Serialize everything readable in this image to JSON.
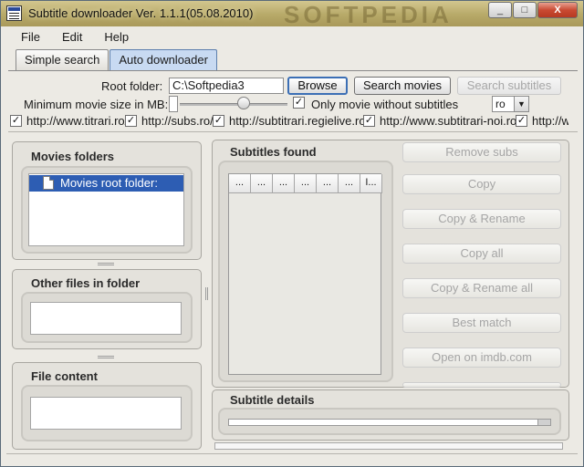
{
  "window": {
    "title": "Subtitle downloader Ver. 1.1.1(05.08.2010)",
    "watermark": "SOFTPEDIA",
    "minimize_glyph": "_",
    "maximize_glyph": "□",
    "close_glyph": "X"
  },
  "menu": [
    "File",
    "Edit",
    "Help"
  ],
  "tabs": [
    {
      "label": "Simple search",
      "active": false
    },
    {
      "label": "Auto downloader",
      "active": true
    }
  ],
  "options": {
    "root_folder_label": "Root folder:",
    "root_folder_value": "C:\\Softpedia3",
    "browse_label": "Browse",
    "search_movies_label": "Search movies",
    "search_subtitles_label": "Search subtitles",
    "min_size_label": "Minimum movie size in MB:",
    "min_size_value": "",
    "only_without_subs_label": "Only movie without subtitles",
    "only_without_subs_checked": true,
    "language_value": "ro",
    "check_glyph": "✓",
    "combo_arrow_glyph": "▼"
  },
  "sites": [
    {
      "url": "http://www.titrari.ro/",
      "checked": true
    },
    {
      "url": "http://subs.ro/",
      "checked": true
    },
    {
      "url": "http://subtitrari.regielive.ro/",
      "checked": true
    },
    {
      "url": "http://www.subtitrari-noi.ro/",
      "checked": true
    },
    {
      "url": "http://w",
      "checked": true
    }
  ],
  "left": {
    "movies_folders_title": "Movies folders",
    "tree_root": "Movies root folder:",
    "other_files_title": "Other files in folder",
    "file_content_title": "File content"
  },
  "subtitles": {
    "found_title": "Subtitles found",
    "columns": [
      "...",
      "...",
      "...",
      "...",
      "...",
      "...",
      "I..."
    ],
    "details_title": "Subtitle details"
  },
  "actions": [
    "Remove subs",
    "Copy",
    "Copy & Rename",
    "Copy all",
    "Copy & Rename all",
    "Best match",
    "Open on imdb.com"
  ]
}
